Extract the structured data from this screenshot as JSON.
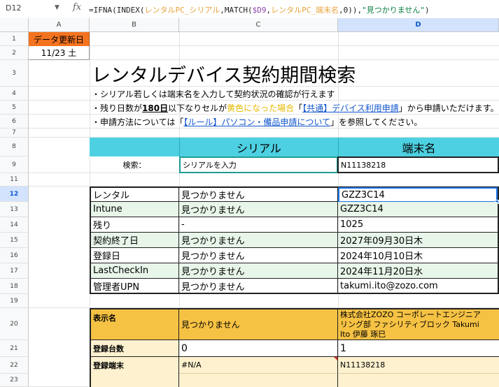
{
  "formula_bar": {
    "name_box": "D12",
    "fx": "fx",
    "formula_prefix": "=IFNA(INDEX(",
    "range1": "レンタルPC_シリアル",
    "formula_mid1": ",MATCH(",
    "ref": "$D9",
    "formula_mid2": ",",
    "range2": "レンタルPC_端末名",
    "formula_mid3": ",0)),",
    "string": "\"見つかりません\"",
    "formula_end": ")"
  },
  "columns": [
    "A",
    "B",
    "C",
    "D"
  ],
  "rows": [
    "1",
    "2",
    "3",
    "4",
    "5",
    "6",
    "7",
    "8",
    "9",
    "11",
    "12",
    "13",
    "14",
    "15",
    "16",
    "17",
    "18",
    "19",
    "20",
    "21",
    "22",
    "23"
  ],
  "header": {
    "update_label": "データ更新日",
    "update_date": "11/23 土",
    "title": "レンタルデバイス契約期間検索",
    "line1": "・シリアル若しくは端末名を入力して契約状況の確認が行えます",
    "line2_a": "・残り日数が",
    "line2_bold": "180日",
    "line2_b": "以下なりセルが",
    "line2_yellow": "黄色になった場合",
    "line2_c": "「",
    "line2_link": "【共通】デバイス利用申請",
    "line2_d": "」から申請いただけます。",
    "line3_a": "・申請方法については「",
    "line3_link": "【ルール】パソコン・備品申請について",
    "line3_b": "」を参照してください。"
  },
  "search": {
    "col_serial": "シリアル",
    "col_terminal": "端末名",
    "label": "検索：",
    "serial_value": "シリアルを入力",
    "terminal_value": "N11138218"
  },
  "result_rows": [
    {
      "label": "レンタル",
      "serial": "見つかりません",
      "terminal": "GZZ3C14"
    },
    {
      "label": "Intune",
      "serial": "見つかりません",
      "terminal": "GZZ3C14"
    },
    {
      "label": "残り",
      "serial": "-",
      "terminal": "1025"
    },
    {
      "label": "契約終了日",
      "serial": "見つかりません",
      "terminal": "2027年09月30日木"
    },
    {
      "label": "登録日",
      "serial": "見つかりません",
      "terminal": "2024年10月10日木"
    },
    {
      "label": "LastCheckIn",
      "serial": "見つかりません",
      "terminal": "2024年11月20日水"
    },
    {
      "label": "管理者UPN",
      "serial": "見つかりません",
      "terminal": "takumi.ito@zozo.com"
    }
  ],
  "user_rows": {
    "display_name_label": "表示名",
    "display_name_serial": "見つかりません",
    "display_name_terminal_1": "株式会社ZOZO コーポレートエンジニア",
    "display_name_terminal_2": "リング部 ファシリティブロック Takumi",
    "display_name_terminal_3": "Ito 伊藤 琢巳",
    "count_label": "登録台数",
    "count_serial": "0",
    "count_terminal": "1",
    "device_label": "登録端末",
    "device_serial": "#N/A",
    "device_terminal": "N11138218"
  },
  "colors": {
    "orange": "#f4731f",
    "cyan": "#4dd0e1",
    "mint": "#e8f5e9",
    "gold": "#f6c244",
    "cream": "#fdf1cf",
    "select": "#1a73e8"
  }
}
